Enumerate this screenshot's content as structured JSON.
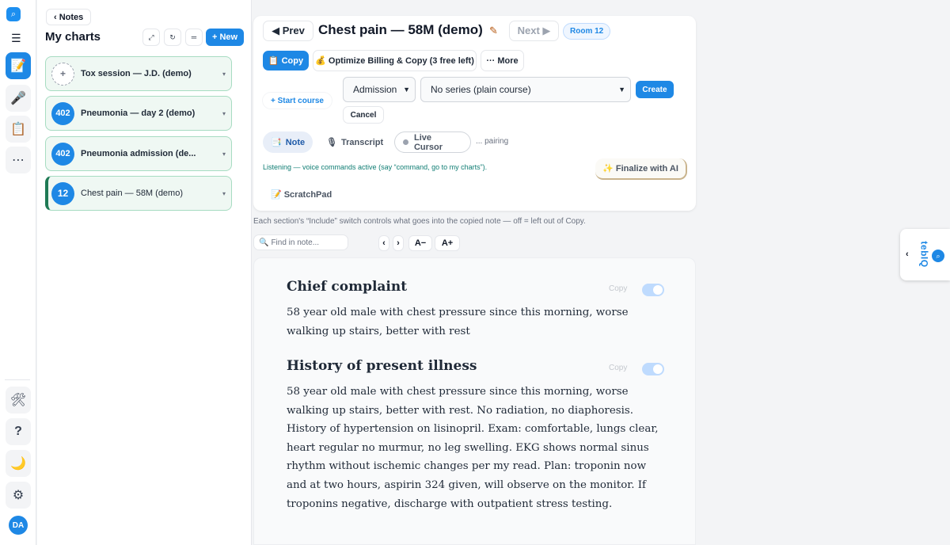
{
  "rail": {
    "logo_icon": "search-icon",
    "items": [
      {
        "icon": "note-icon",
        "glyph": "📝",
        "active": true
      },
      {
        "icon": "microphone-icon",
        "glyph": "🎤",
        "active": false
      },
      {
        "icon": "clipboard-icon",
        "glyph": "📋",
        "active": false
      },
      {
        "icon": "more-icon",
        "glyph": "⋯",
        "active": false
      }
    ],
    "bottom_items": [
      {
        "icon": "tools-icon",
        "glyph": "🛠"
      },
      {
        "icon": "help-icon",
        "glyph": "?"
      },
      {
        "icon": "moon-icon",
        "glyph": "🌙"
      },
      {
        "icon": "gear-icon",
        "glyph": "⚙"
      }
    ],
    "avatar": "DA"
  },
  "charts": {
    "back_label": "‹ Notes",
    "title": "My charts",
    "new_label": "+ New",
    "items": [
      {
        "badge": "+",
        "title": "Tox session — J.D. (demo)",
        "menu": "▾"
      },
      {
        "badge": "402",
        "title": "Pneumonia — day 2 (demo)",
        "menu": "▾"
      },
      {
        "badge": "402",
        "title": "Pneumonia admission (de...",
        "menu": "▾"
      },
      {
        "badge": "12",
        "title": "Chest pain — 58M (demo)",
        "menu": "▾"
      }
    ]
  },
  "header": {
    "prev_label": "◀ Prev",
    "patient_title": "Chest pain — 58M (demo)",
    "next_label": "Next ▶",
    "room": "Room 12"
  },
  "actions": {
    "copy_label": "📋 Copy",
    "optimize_label": "💰 Optimize Billing & Copy (3 free left)",
    "more_label": "··· More"
  },
  "course": {
    "start_label": "+ Start course",
    "type_value": "Admission",
    "series_value": "No series (plain course)",
    "create_label": "Create",
    "cancel_label": "Cancel"
  },
  "tabs": {
    "note_label": "Note",
    "transcript_label": "Transcript",
    "live_cursor_label": "Live Cursor",
    "pairing": "... pairing"
  },
  "status": {
    "listening": "Listening — voice commands active (say “command, go to my charts”).",
    "finalize_label": "✨ Finalize with AI",
    "scratchpad_label": "ScratchPad"
  },
  "include_note": "Each section's “Include” switch controls what goes into the copied note — off = left out of Copy.",
  "find": {
    "placeholder": "Find in note...",
    "prev": "‹",
    "next": "›",
    "font_down": "A−",
    "font_up": "A+"
  },
  "sections": [
    {
      "title": "Chief complaint",
      "copy_label": "Copy",
      "include": true,
      "text": "58 year old male with chest pressure since this morning, worse walking up stairs, better with rest"
    },
    {
      "title": "History of present illness",
      "copy_label": "Copy",
      "include": true,
      "text": "58 year old male with chest pressure since this morning, worse walking up stairs, better with rest. No radiation, no diaphoresis. History of hypertension on lisinopril. Exam: comfortable, lungs clear, heart regular no murmur, no leg swelling. EKG shows normal sinus rhythm without ischemic changes per my read. Plan: troponin now and at two hours, aspirin 324 given, will observe on the monitor. If troponins negative, discharge with outpatient stress testing."
    }
  ],
  "widget": {
    "chevron": "‹",
    "brand": "tebIQ"
  },
  "colors": {
    "accent": "#1e88e5",
    "chart_item_bg": "#eff8f3",
    "chart_item_border": "#a7dcc2"
  }
}
